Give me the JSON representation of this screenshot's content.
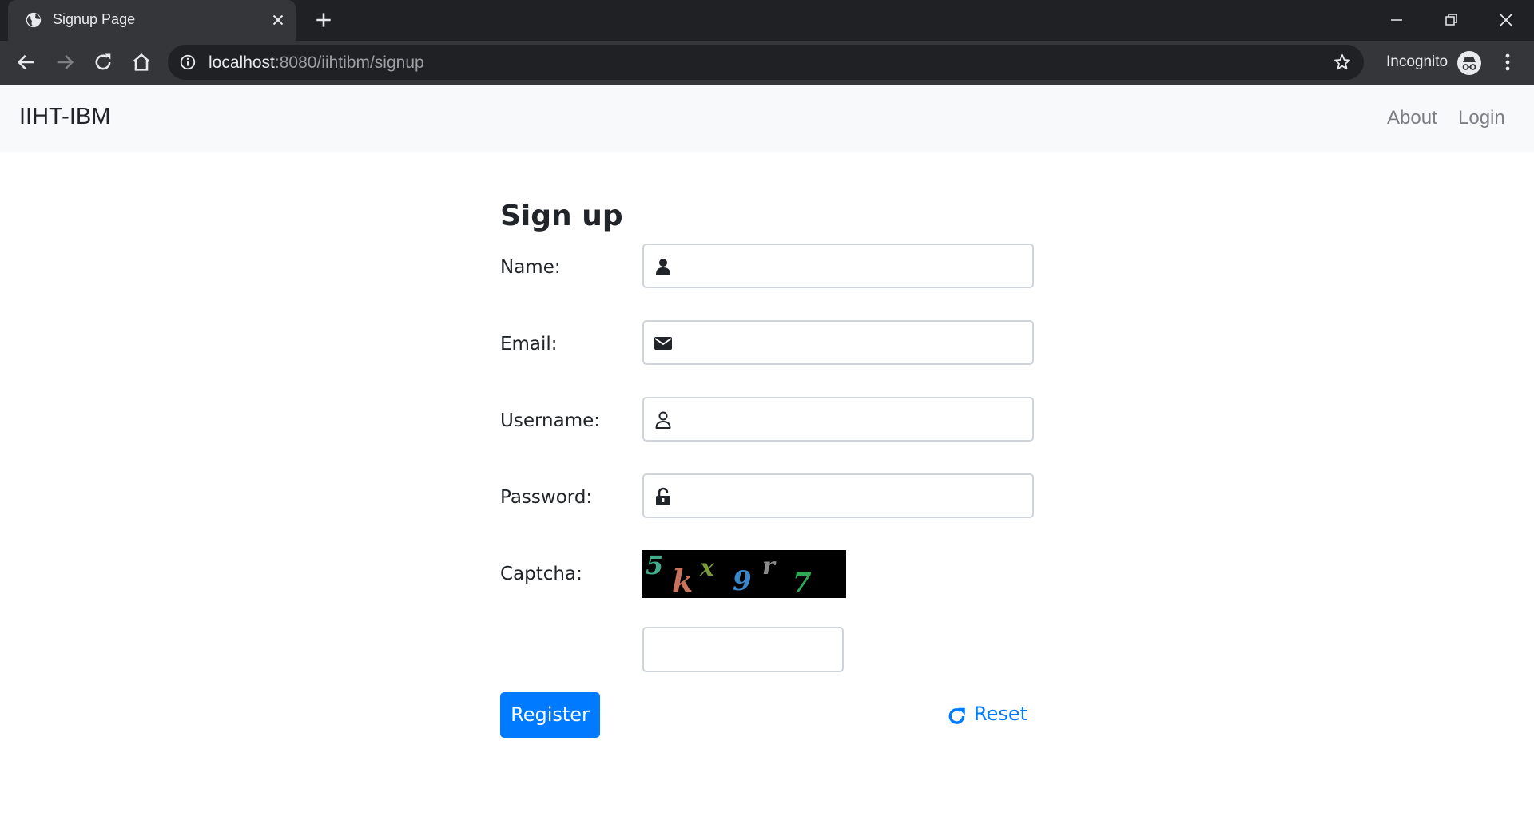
{
  "browser": {
    "tab_title": "Signup Page",
    "url_host": "localhost",
    "url_path": ":8080/iihtibm/signup",
    "incognito_label": "Incognito",
    "icons": [
      "globe-icon",
      "close-icon",
      "plus-icon",
      "minimize-icon",
      "restore-icon",
      "window-close-icon",
      "back-arrow-icon",
      "forward-arrow-icon",
      "reload-icon",
      "home-icon",
      "info-icon",
      "star-icon",
      "incognito-icon",
      "kebab-menu-icon"
    ]
  },
  "navbar": {
    "brand": "IIHT-IBM",
    "links": [
      {
        "label": "About"
      },
      {
        "label": "Login"
      }
    ]
  },
  "form": {
    "heading": "Sign up",
    "fields": [
      {
        "label": "Name:",
        "icon": "user-solid-icon",
        "value": ""
      },
      {
        "label": "Email:",
        "icon": "envelope-icon",
        "value": ""
      },
      {
        "label": "Username:",
        "icon": "user-outline-icon",
        "value": ""
      },
      {
        "label": "Password:",
        "icon": "unlock-icon",
        "value": ""
      }
    ],
    "captcha": {
      "label": "Captcha:",
      "chars": [
        {
          "ch": "5",
          "color": "#3fae8c"
        },
        {
          "ch": "k",
          "color": "#c9735c"
        },
        {
          "ch": "x",
          "color": "#7a9a3c"
        },
        {
          "ch": "9",
          "color": "#3a86c8"
        },
        {
          "ch": "r",
          "color": "#8c8c8c"
        },
        {
          "ch": "7",
          "color": "#2eaa55"
        }
      ],
      "input_value": ""
    },
    "register_label": "Register",
    "reset_label": "Reset"
  },
  "colors": {
    "accent": "#007bff",
    "navbar_bg": "#f8f9fa",
    "chrome_dark": "#202124",
    "chrome_mid": "#35363a"
  }
}
